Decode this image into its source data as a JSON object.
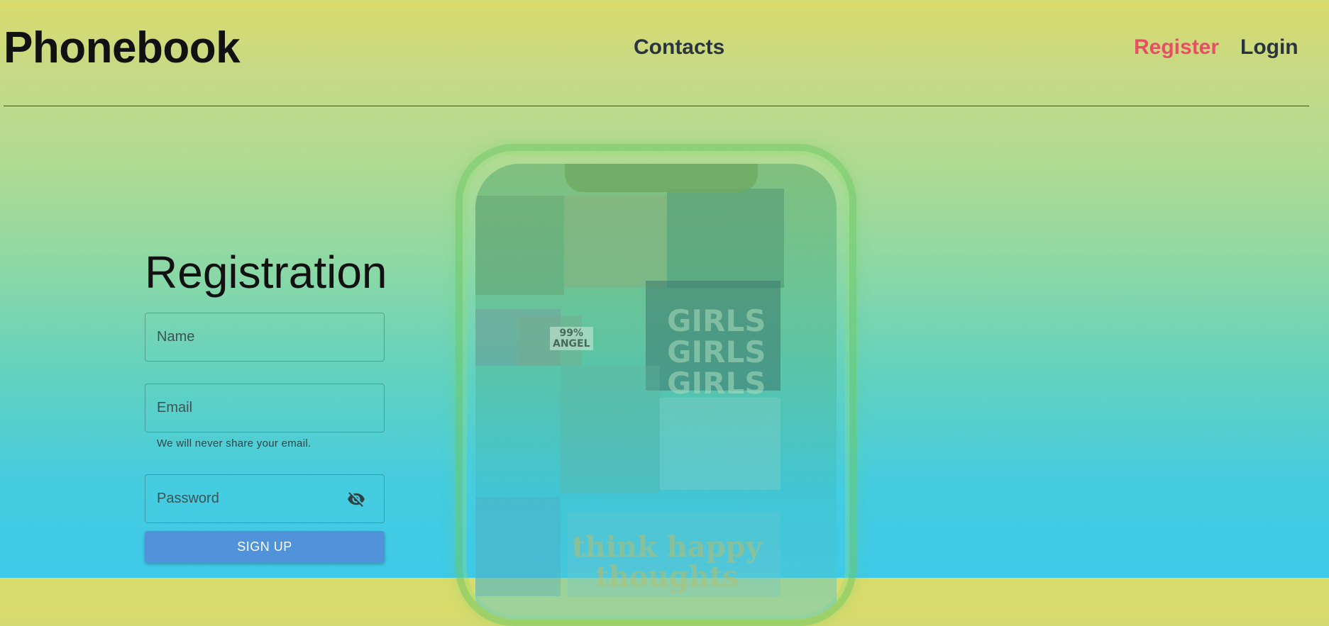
{
  "header": {
    "logo": "Phonebook",
    "nav": {
      "contacts": "Contacts",
      "register": "Register",
      "login": "Login"
    },
    "active_color": "#e94f64"
  },
  "phone_mockup": {
    "texts": {
      "girls": "GIRLS\nGIRLS\nGIRLS",
      "angel": "99%\nANGEL",
      "happy": "think happy thoughts"
    }
  },
  "form": {
    "title": "Registration",
    "name_placeholder": "Name",
    "email_placeholder": "Email",
    "email_helper": "We will never share your email.",
    "password_placeholder": "Password",
    "password_toggle_icon": "visibility-off-icon",
    "submit_label": "SIGN UP",
    "submit_color": "#5193da"
  }
}
